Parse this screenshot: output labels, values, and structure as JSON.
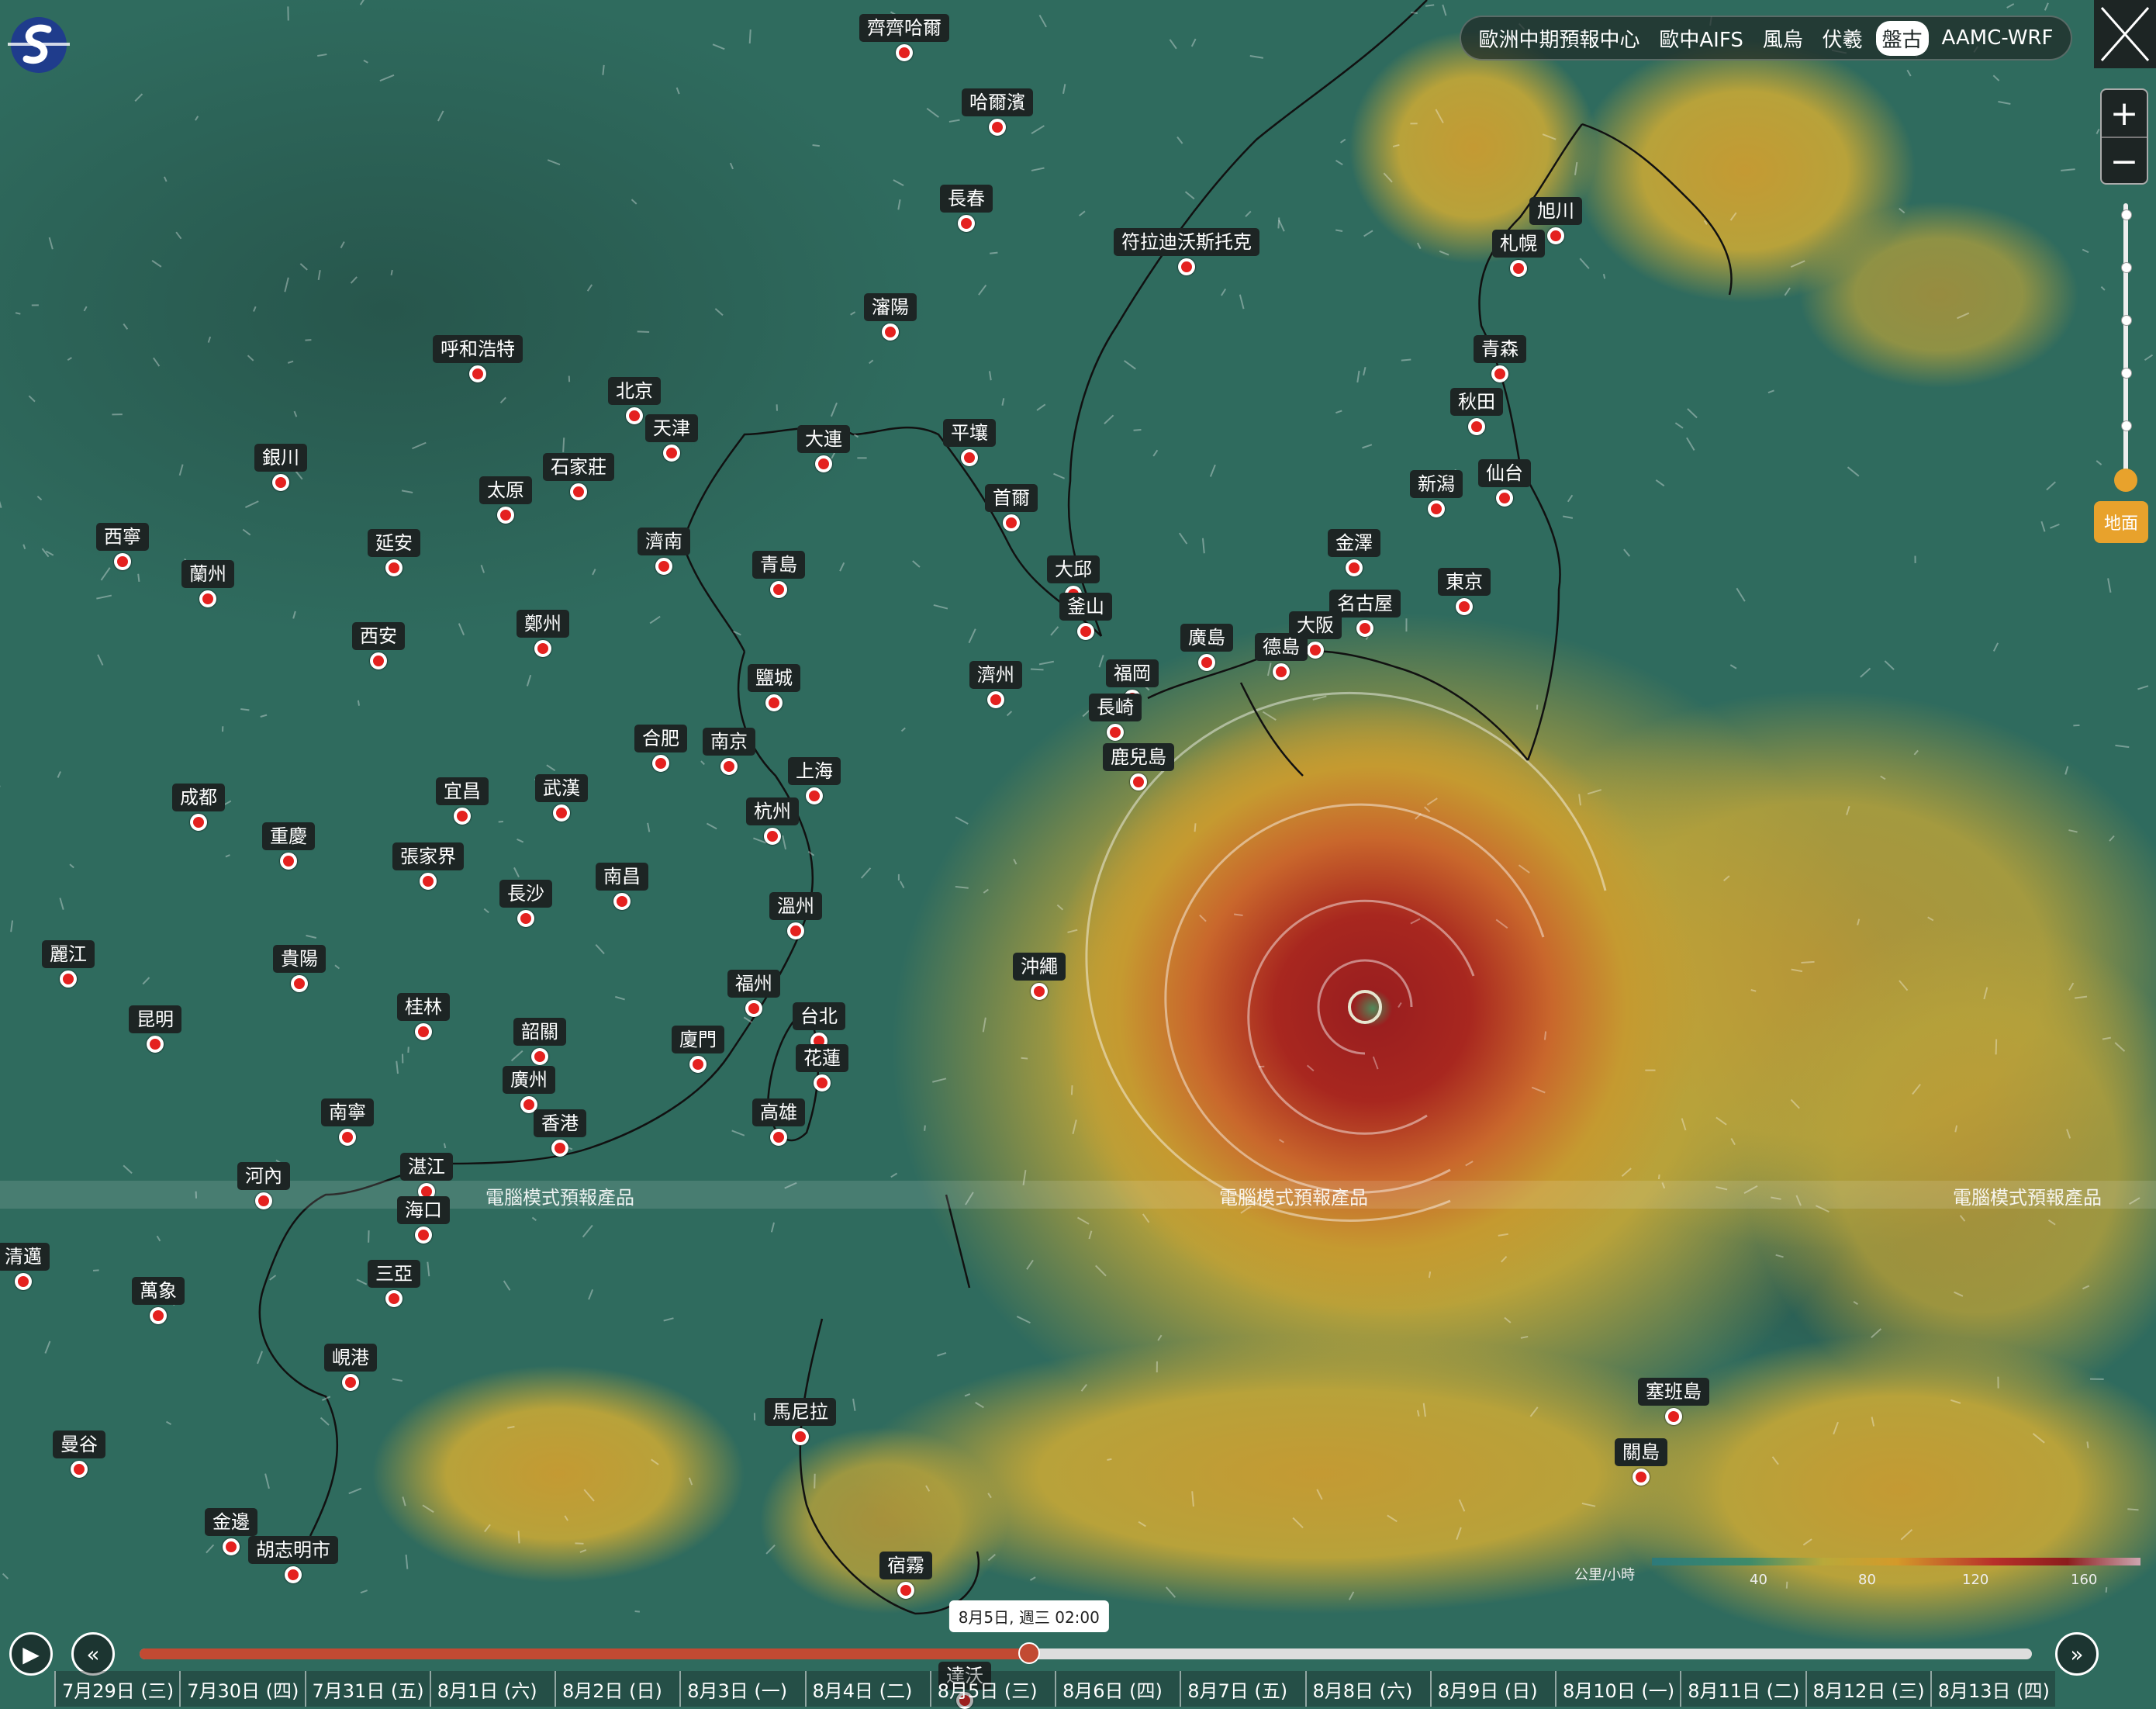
{
  "model_selector": {
    "models": [
      "歐洲中期預報中心",
      "歐中AIFS",
      "風烏",
      "伏羲",
      "盤古",
      "AAMC-WRF"
    ],
    "active": "盤古"
  },
  "watermark": "電腦模式預報產品",
  "level_label": "地面",
  "legend": {
    "unit": "公里/小時",
    "ticks": [
      "40",
      "80",
      "120",
      "160"
    ]
  },
  "timeline": {
    "tooltip": "8月5日, 週三 02:00",
    "progress_percent": 47,
    "days": [
      "7月29日 (三)",
      "7月30日 (四)",
      "7月31日 (五)",
      "8月1日 (六)",
      "8月2日 (日)",
      "8月3日 (一)",
      "8月4日 (二)",
      "8月5日 (三)",
      "8月6日 (四)",
      "8月7日 (五)",
      "8月8日 (六)",
      "8月9日 (日)",
      "8月10日 (一)",
      "8月11日 (二)",
      "8月12日 (三)",
      "8月13日 (四)"
    ]
  },
  "icons": {
    "logo": "logo-icon",
    "close": "close-icon",
    "zoom_in": "plus-icon",
    "zoom_out": "minus-icon",
    "play": "play-icon",
    "rewind": "rewind-icon",
    "forward": "forward-icon"
  },
  "cities": [
    "齊齊哈爾",
    "哈爾濱",
    "長春",
    "符拉迪沃斯托克",
    "瀋陽",
    "旭川",
    "札幌",
    "呼和浩特",
    "北京",
    "天津",
    "青森",
    "秋田",
    "銀川",
    "石家莊",
    "大連",
    "平壤",
    "太原",
    "首爾",
    "仙台",
    "新潟",
    "西寧",
    "延安",
    "濟南",
    "青島",
    "金澤",
    "蘭州",
    "大邱",
    "東京",
    "名古屋",
    "釜山",
    "鄭州",
    "大阪",
    "西安",
    "廣島",
    "德島",
    "濟州",
    "福岡",
    "鹽城",
    "長崎",
    "合肥",
    "南京",
    "上海",
    "鹿兒島",
    "成都",
    "宜昌",
    "武漢",
    "杭州",
    "重慶",
    "張家界",
    "南昌",
    "長沙",
    "溫州",
    "麗江",
    "貴陽",
    "沖繩",
    "福州",
    "昆明",
    "桂林",
    "台北",
    "韶關",
    "廈門",
    "花蓮",
    "廣州",
    "高雄",
    "南寧",
    "香港",
    "湛江",
    "河內",
    "海口",
    "清邁",
    "萬象",
    "三亞",
    "峴港",
    "塞班島",
    "馬尼拉",
    "關島",
    "曼谷",
    "金邊",
    "胡志明市",
    "宿霧",
    "達沃"
  ]
}
